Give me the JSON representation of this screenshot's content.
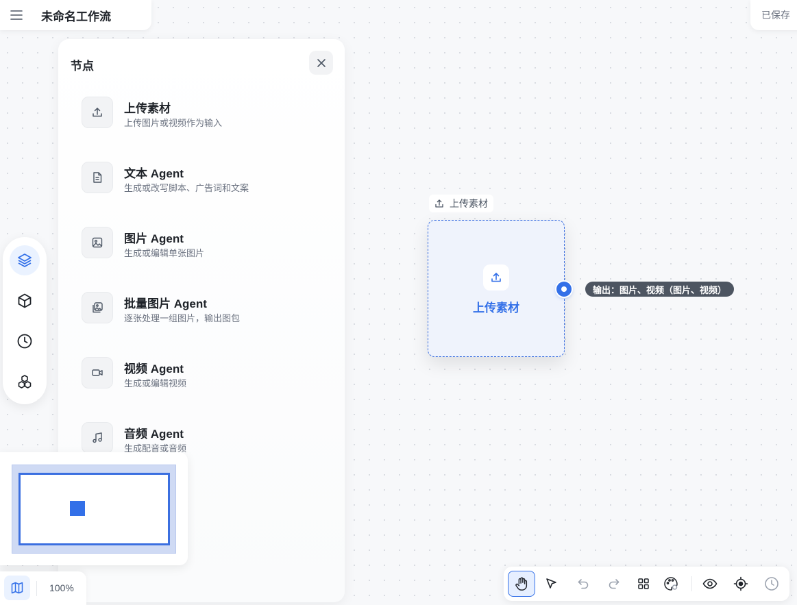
{
  "header": {
    "title": "未命名工作流",
    "save_status": "已保存"
  },
  "panel": {
    "title": "节点",
    "items": [
      {
        "name": "上传素材",
        "desc": "上传图片或视频作为输入",
        "icon": "upload-icon"
      },
      {
        "name": "文本 Agent",
        "desc": "生成或改写脚本、广告词和文案",
        "icon": "document-icon"
      },
      {
        "name": "图片 Agent",
        "desc": "生成或编辑单张图片",
        "icon": "image-icon"
      },
      {
        "name": "批量图片 Agent",
        "desc": "逐张处理一组图片，输出图包",
        "icon": "images-icon"
      },
      {
        "name": "视频 Agent",
        "desc": "生成或编辑视频",
        "icon": "video-icon"
      },
      {
        "name": "音频 Agent",
        "desc": "生成配音或音频",
        "icon": "music-icon"
      }
    ]
  },
  "canvas": {
    "node": {
      "header": "上传素材",
      "label": "上传素材",
      "output_tooltip": "输出：图片、视频（图片、视频）"
    }
  },
  "zoom": {
    "value": "100%"
  },
  "toolbar": {
    "tools": [
      "hand-icon",
      "pointer-icon",
      "undo-icon",
      "redo-icon",
      "grid-icon",
      "palette-icon",
      "eye-icon",
      "locate-icon",
      "history-icon"
    ],
    "active": "hand-icon"
  },
  "colors": {
    "accent": "#3370e8",
    "tooltip_bg": "#4d5561"
  }
}
